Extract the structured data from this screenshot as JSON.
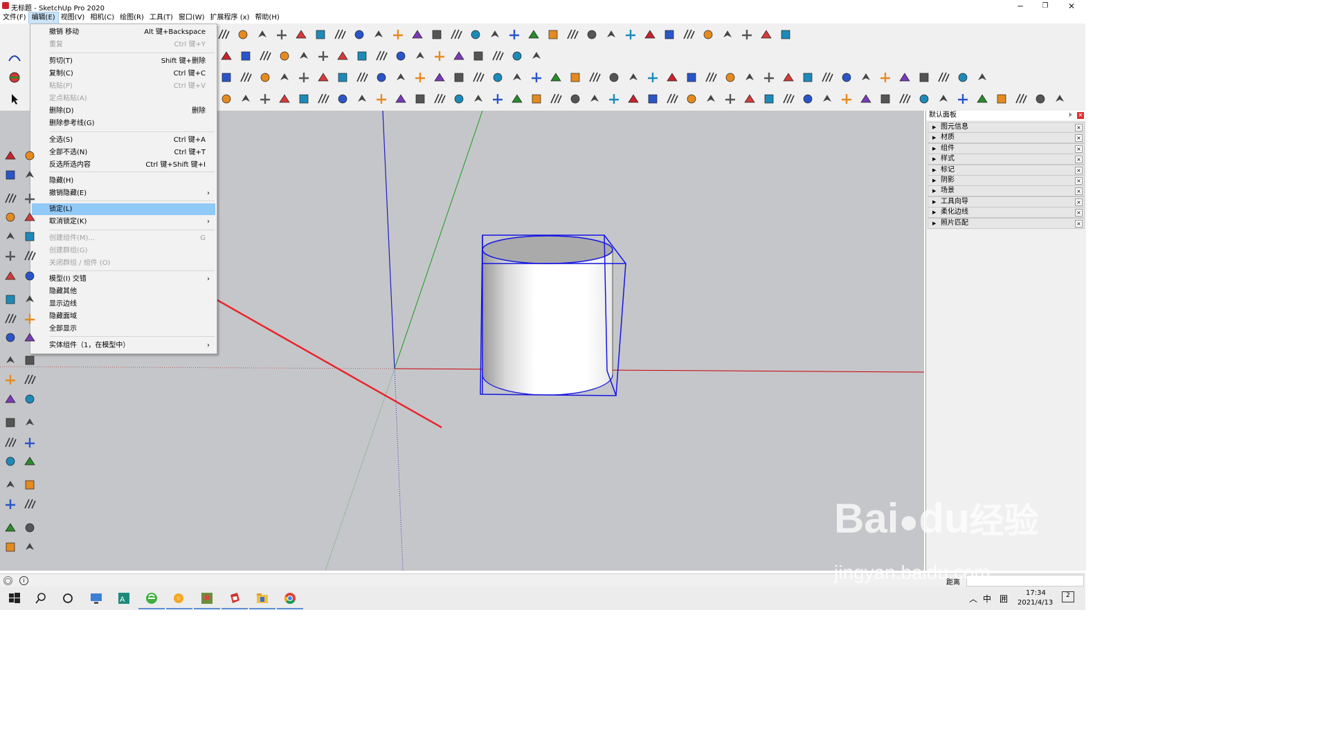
{
  "window": {
    "title": "无标题 - SketchUp Pro 2020",
    "controls": [
      "minimize-icon",
      "restore-icon",
      "close-icon"
    ]
  },
  "menubar": [
    "文件(F)",
    "编辑(E)",
    "视图(V)",
    "相机(C)",
    "绘图(R)",
    "工具(T)",
    "窗口(W)",
    "扩展程序 (x)",
    "帮助(H)"
  ],
  "edit_menu": {
    "items": [
      {
        "label": "撤销 移动",
        "shortcut": "Alt 键+Backspace",
        "disabled": false
      },
      {
        "label": "重复",
        "shortcut": "Ctrl 键+Y",
        "disabled": true
      },
      {
        "label": "剪切(T)",
        "shortcut": "Shift 键+删除",
        "disabled": false
      },
      {
        "label": "复制(C)",
        "shortcut": "Ctrl 键+C",
        "disabled": false
      },
      {
        "label": "粘贴(P)",
        "shortcut": "Ctrl 键+V",
        "disabled": true
      },
      {
        "label": "定点粘贴(A)",
        "shortcut": "",
        "disabled": true
      },
      {
        "label": "删除(D)",
        "shortcut": "删除",
        "disabled": false
      },
      {
        "label": "删除参考线(G)",
        "shortcut": "",
        "disabled": false
      },
      {
        "label": "全选(S)",
        "shortcut": "Ctrl 键+A",
        "disabled": false
      },
      {
        "label": "全部不选(N)",
        "shortcut": "Ctrl 键+T",
        "disabled": false
      },
      {
        "label": "反选所选内容",
        "shortcut": "Ctrl 键+Shift 键+I",
        "disabled": false
      },
      {
        "label": "隐藏(H)",
        "shortcut": "",
        "disabled": false
      },
      {
        "label": "撤销隐藏(E)",
        "shortcut": "",
        "disabled": false,
        "submenu": true
      },
      {
        "label": "锁定(L)",
        "shortcut": "",
        "disabled": false,
        "highlighted": true
      },
      {
        "label": "取消锁定(K)",
        "shortcut": "",
        "disabled": false,
        "submenu": true
      },
      {
        "label": "创建组件(M)...",
        "shortcut": "G",
        "disabled": true
      },
      {
        "label": "创建群组(G)",
        "shortcut": "",
        "disabled": true
      },
      {
        "label": "关闭群组 / 组件 (O)",
        "shortcut": "",
        "disabled": true
      },
      {
        "label": "模型(I) 交错",
        "shortcut": "",
        "disabled": false,
        "submenu": true
      },
      {
        "label": "隐藏其他",
        "shortcut": "",
        "disabled": false
      },
      {
        "label": "显示边线",
        "shortcut": "",
        "disabled": false
      },
      {
        "label": "隐藏面域",
        "shortcut": "",
        "disabled": false
      },
      {
        "label": "全部显示",
        "shortcut": "",
        "disabled": false
      },
      {
        "label": "实体组件（1，在模型中）",
        "shortcut": "",
        "disabled": false,
        "submenu": true
      }
    ]
  },
  "default_tray": {
    "title": "默认面板",
    "panels": [
      "图元信息",
      "材质",
      "组件",
      "样式",
      "标记",
      "阴影",
      "场景",
      "工具向导",
      "柔化边线",
      "照片匹配"
    ]
  },
  "statusbar": {
    "measure_label": "距离"
  },
  "taskbar": {
    "ime": "中",
    "layout": "囲",
    "time": "17:34",
    "date": "2021/4/13",
    "notifications": "2"
  },
  "watermark": {
    "brand": "Bai",
    "brand2": "du",
    "cn": "经验",
    "url": "jingyan.baidu.com"
  },
  "colors": {
    "viewport": "#c5c6ca",
    "selection": "#1515e0",
    "axis_red": "#c80000",
    "axis_green": "#1a9a1a",
    "axis_blue": "#1d1dbd",
    "menu_highlight": "#91c9f7",
    "annotation_arrow": "#e8252b"
  }
}
